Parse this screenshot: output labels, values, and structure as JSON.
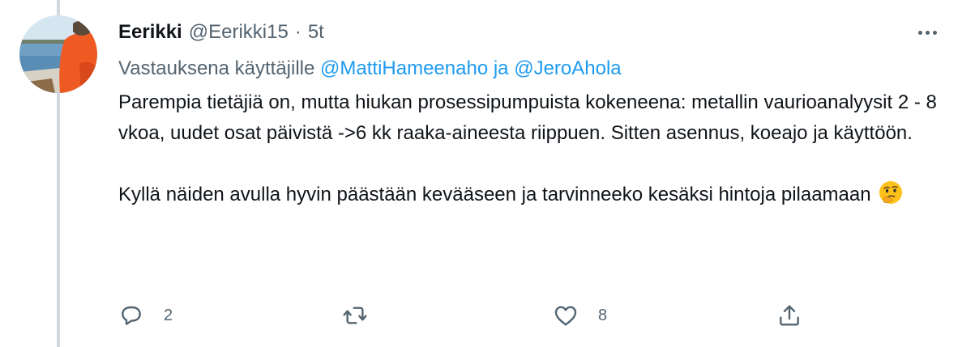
{
  "tweet": {
    "author": {
      "display_name": "Eerikki",
      "handle": "@Eerikki15",
      "separator": "·",
      "time": "5t"
    },
    "reply_context": {
      "prefix": "Vastauksena käyttäjille",
      "mention_1": "@MattiHameenaho",
      "conjunction": "ja",
      "mention_2": "@JeroAhola"
    },
    "body": {
      "paragraph_1": "Parempia tietäjiä on, mutta hiukan prosessipumpuista kokeneena: metallin vaurioanalyysit 2 - 8 vkoa, uudet osat päivistä ->6 kk raaka-aineesta riippuen. Sitten asennus, koeajo ja käyttöön.",
      "paragraph_2": "Kyllä näiden avulla hyvin päästään kevääseen ja tarvinneeko kesäksi hintoja pilaamaan",
      "emoji": "thinking-face-emoji"
    },
    "actions": {
      "reply_count": "2",
      "retweet_count": "",
      "like_count": "8"
    }
  },
  "icons": {
    "more": "more-horizontal-icon",
    "reply": "reply-bubble-icon",
    "retweet": "retweet-icon",
    "like": "heart-icon",
    "share": "share-icon"
  },
  "colors": {
    "text_primary": "#0f1419",
    "text_secondary": "#536471",
    "accent": "#1d9bf0",
    "thread_line": "#cfd9de"
  }
}
